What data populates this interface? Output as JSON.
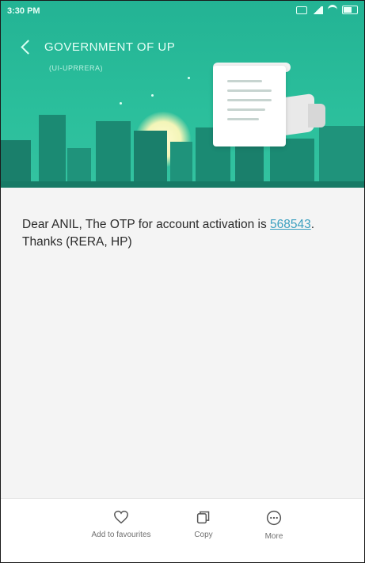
{
  "status_bar": {
    "time": "3:30 PM"
  },
  "header": {
    "title": "GOVERNMENT OF UP",
    "subtitle": "(UI-UPRRERA)"
  },
  "message": {
    "text_before": "Dear ANIL, The OTP for account activation is ",
    "otp": "568543",
    "text_after": ". Thanks (RERA, HP)"
  },
  "bottom_bar": {
    "favourites_label": "Add to favourites",
    "copy_label": "Copy",
    "more_label": "More"
  },
  "colors": {
    "header": "#2bbf9c",
    "link": "#3a9fbf"
  },
  "icons": [
    "back-arrow-icon",
    "heart-icon",
    "copy-icon",
    "more-icon"
  ]
}
